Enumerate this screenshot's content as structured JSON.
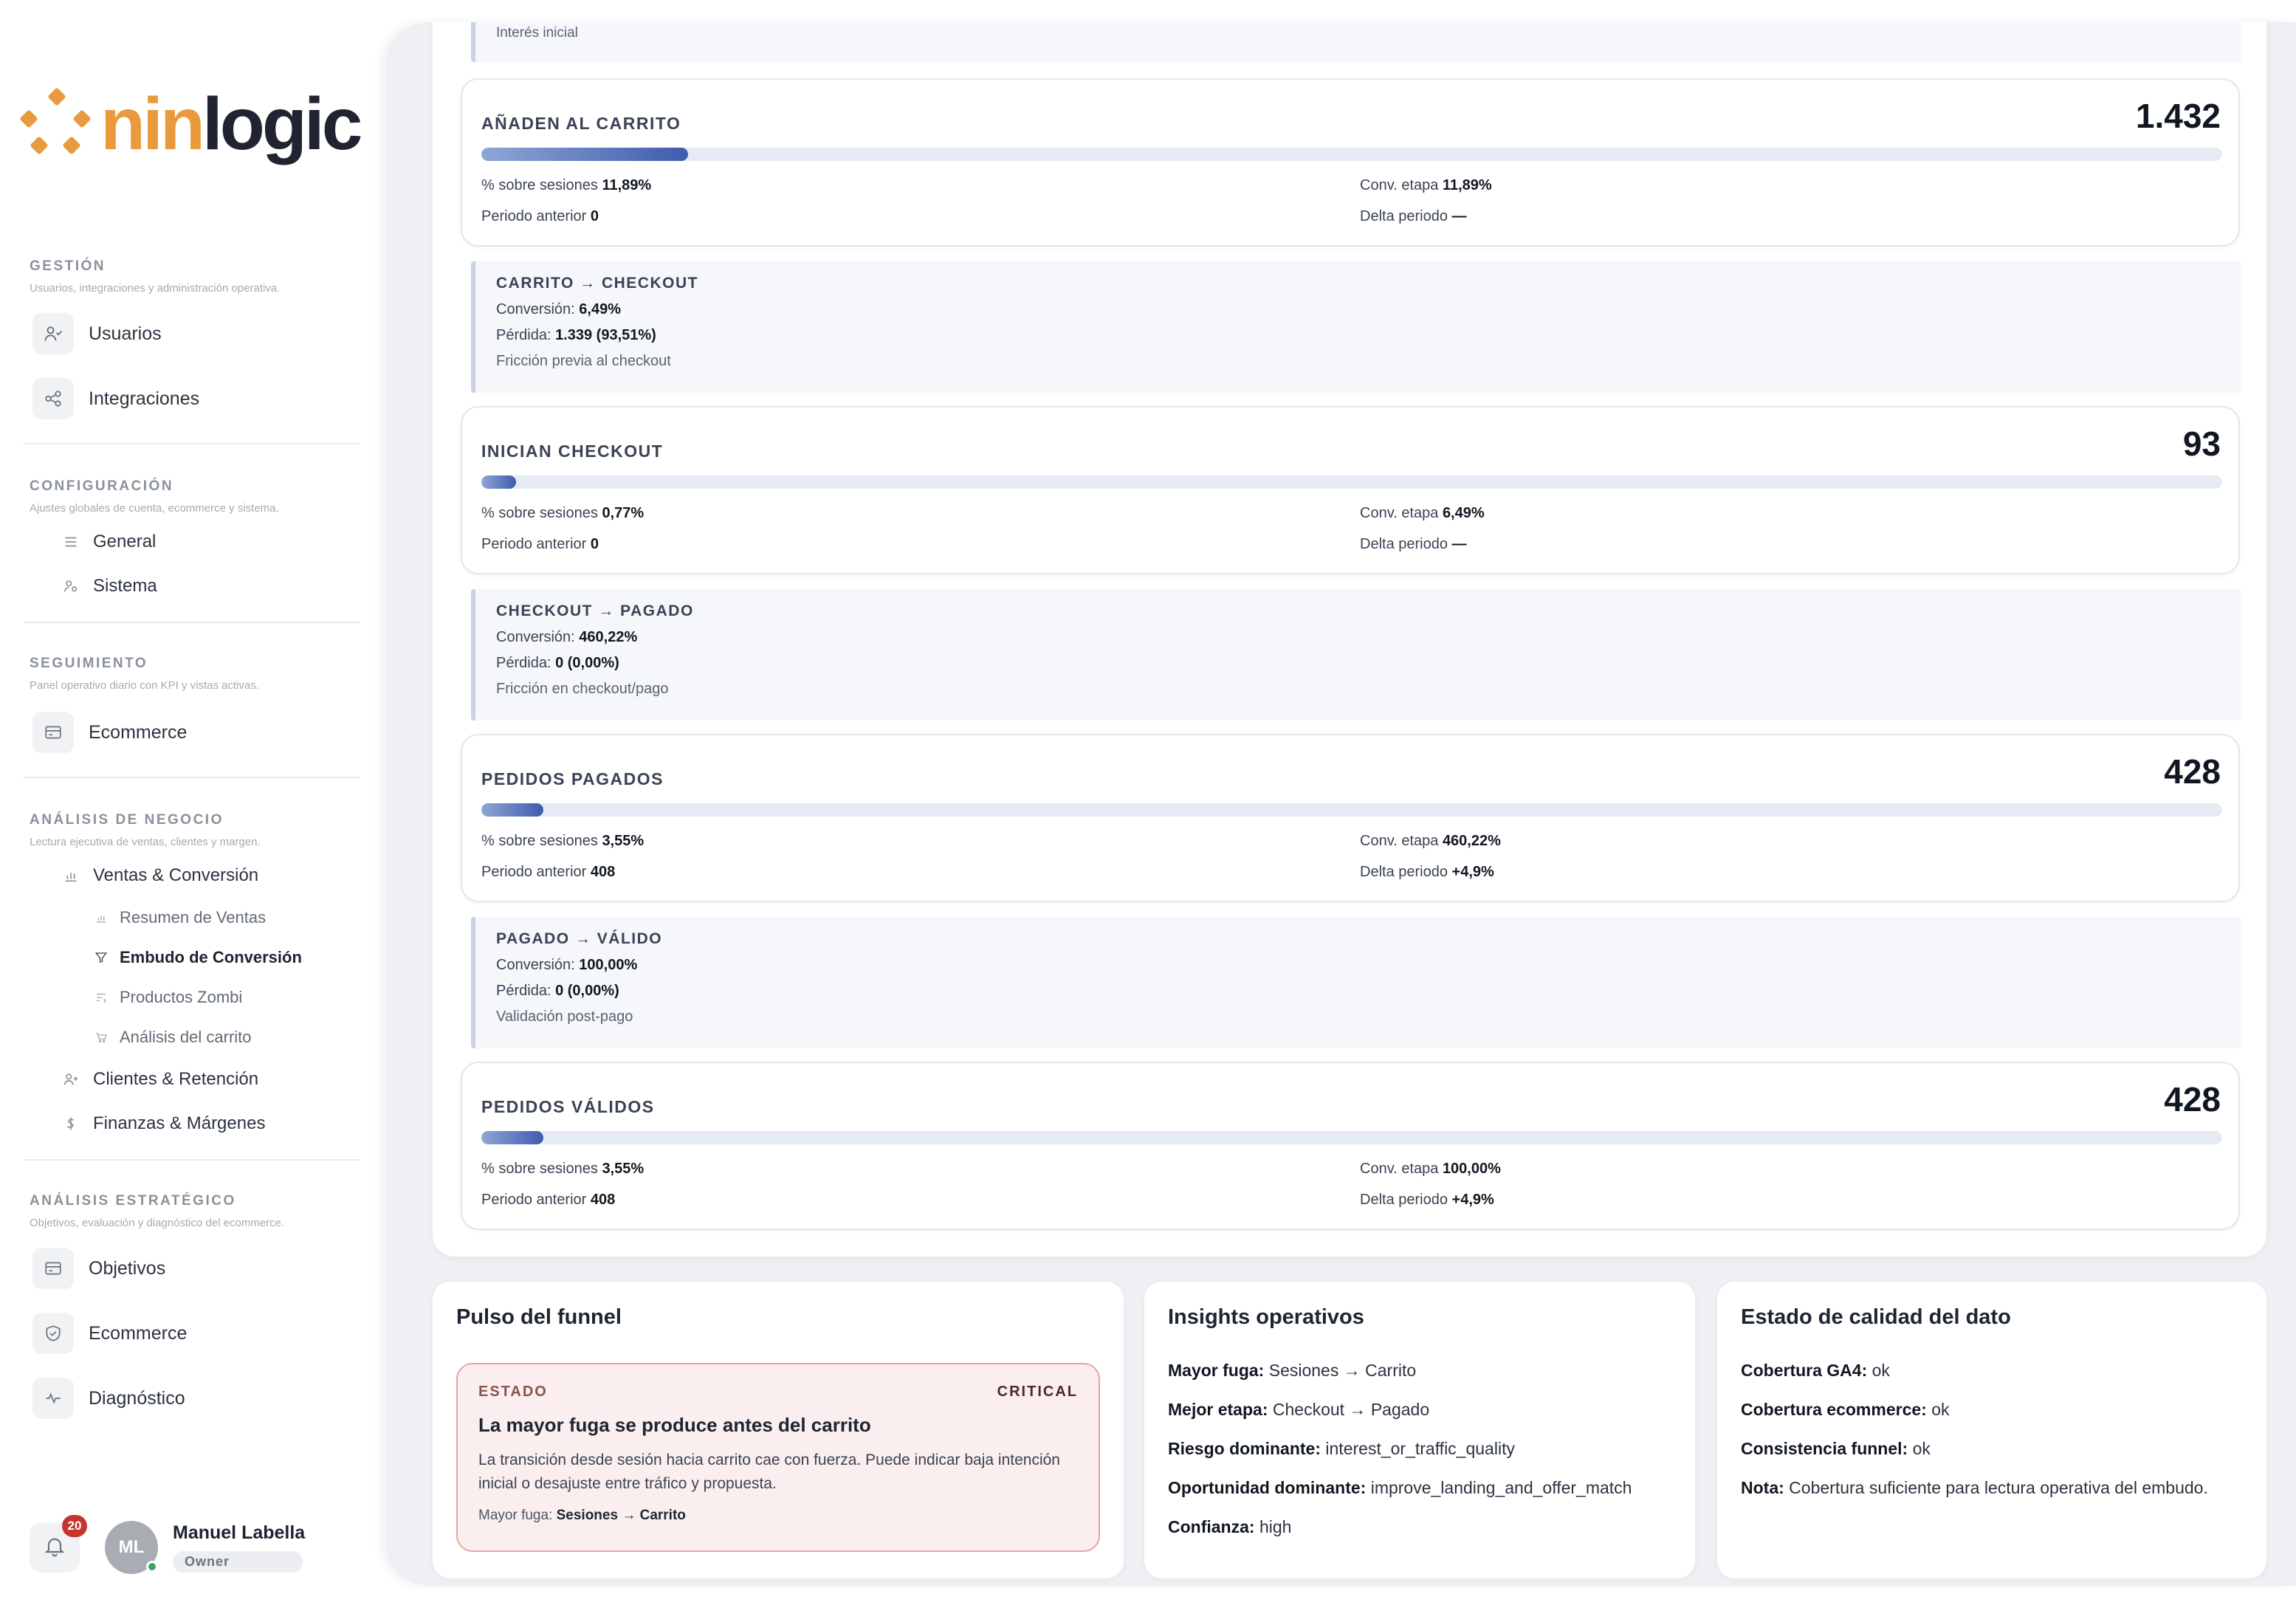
{
  "brand": {
    "logo_part1": "nin",
    "logo_part2": "logic"
  },
  "sidebar": {
    "sections": [
      {
        "title": "GESTIÓN",
        "desc": "Usuarios, integraciones y administración operativa."
      },
      {
        "title": "CONFIGURACIÓN",
        "desc": "Ajustes globales de cuenta, ecommerce y sistema."
      },
      {
        "title": "SEGUIMIENTO",
        "desc": "Panel operativo diario con KPI y vistas activas."
      },
      {
        "title": "ANÁLISIS DE NEGOCIO",
        "desc": "Lectura ejecutiva de ventas, clientes y margen."
      },
      {
        "title": "ANÁLISIS ESTRATÉGICO",
        "desc": "Objetivos, evaluación y diagnóstico del ecommerce."
      }
    ],
    "items": {
      "usuarios": "Usuarios",
      "integraciones": "Integraciones",
      "general": "General",
      "sistema": "Sistema",
      "ecommerce": "Ecommerce",
      "ventas": "Ventas & Conversión",
      "resumen": "Resumen de Ventas",
      "embudo": "Embudo de Conversión",
      "zombi": "Productos Zombi",
      "carrito": "Análisis del carrito",
      "clientes": "Clientes & Retención",
      "finanzas": "Finanzas & Márgenes",
      "objetivos": "Objetivos",
      "ecommerce2": "Ecommerce",
      "diagnostico": "Diagnóstico"
    },
    "active_item": "Embudo de Conversión"
  },
  "user": {
    "notifications": "20",
    "initials": "ML",
    "name": "Manuel Labella",
    "role": "Owner"
  },
  "funnel": {
    "top_note": "Interés inicial",
    "metric_labels": {
      "sobre_sesiones": "% sobre sesiones",
      "periodo_anterior": "Periodo anterior",
      "conv_etapa": "Conv. etapa",
      "delta_periodo": "Delta periodo",
      "conversion": "Conversión:",
      "perdida": "Pérdida:"
    },
    "stages": [
      {
        "title": "AÑADEN AL CARRITO",
        "value": "1.432",
        "progress": 0.1189,
        "sobre_sesiones": "11,89%",
        "periodo_anterior": "0",
        "conv_etapa": "11,89%",
        "delta": "—"
      },
      {
        "title": "INICIAN CHECKOUT",
        "value": "93",
        "progress": 0.0077,
        "sobre_sesiones": "0,77%",
        "periodo_anterior": "0",
        "conv_etapa": "6,49%",
        "delta": "—"
      },
      {
        "title": "PEDIDOS PAGADOS",
        "value": "428",
        "progress": 0.0355,
        "sobre_sesiones": "3,55%",
        "periodo_anterior": "408",
        "conv_etapa": "460,22%",
        "delta": "+4,9%"
      },
      {
        "title": "PEDIDOS VÁLIDOS",
        "value": "428",
        "progress": 0.0355,
        "sobre_sesiones": "3,55%",
        "periodo_anterior": "408",
        "conv_etapa": "100,00%",
        "delta": "+4,9%"
      }
    ],
    "transitions": [
      {
        "title": "CARRITO → CHECKOUT",
        "conversion": "6,49%",
        "perdida": "1.339 (93,51%)",
        "note": "Fricción previa al checkout"
      },
      {
        "title": "CHECKOUT → PAGADO",
        "conversion": "460,22%",
        "perdida": "0 (0,00%)",
        "note": "Fricción en checkout/pago"
      },
      {
        "title": "PAGADO → VÁLIDO",
        "conversion": "100,00%",
        "perdida": "0 (0,00%)",
        "note": "Validación post-pago"
      }
    ]
  },
  "pulse": {
    "title": "Pulso del funnel",
    "status_label": "ESTADO",
    "status_level": "CRITICAL",
    "headline": "La mayor fuga se produce antes del carrito",
    "body": "La transición desde sesión hacia carrito cae con fuerza. Puede indicar baja intención inicial o desajuste entre tráfico y propuesta.",
    "foot_label": "Mayor fuga:",
    "foot_value": "Sesiones → Carrito"
  },
  "insights": {
    "title": "Insights operativos",
    "rows": [
      {
        "k": "Mayor fuga:",
        "v": "Sesiones → Carrito"
      },
      {
        "k": "Mejor etapa:",
        "v": "Checkout → Pagado"
      },
      {
        "k": "Riesgo dominante:",
        "v": "interest_or_traffic_quality"
      },
      {
        "k": "Oportunidad dominante:",
        "v": "improve_landing_and_offer_match"
      },
      {
        "k": "Confianza:",
        "v": "high"
      }
    ]
  },
  "quality": {
    "title": "Estado de calidad del dato",
    "rows": [
      {
        "k": "Cobertura GA4:",
        "v": "ok"
      },
      {
        "k": "Cobertura ecommerce:",
        "v": "ok"
      },
      {
        "k": "Consistencia funnel:",
        "v": "ok"
      },
      {
        "k": "Nota:",
        "v": "Cobertura suficiente para lectura operativa del embudo."
      }
    ]
  },
  "colors": {
    "accent": "#e89a3c",
    "progress": "#3e5cae",
    "critical_bg": "#fbeeee",
    "critical_border": "#e8a4a2"
  }
}
